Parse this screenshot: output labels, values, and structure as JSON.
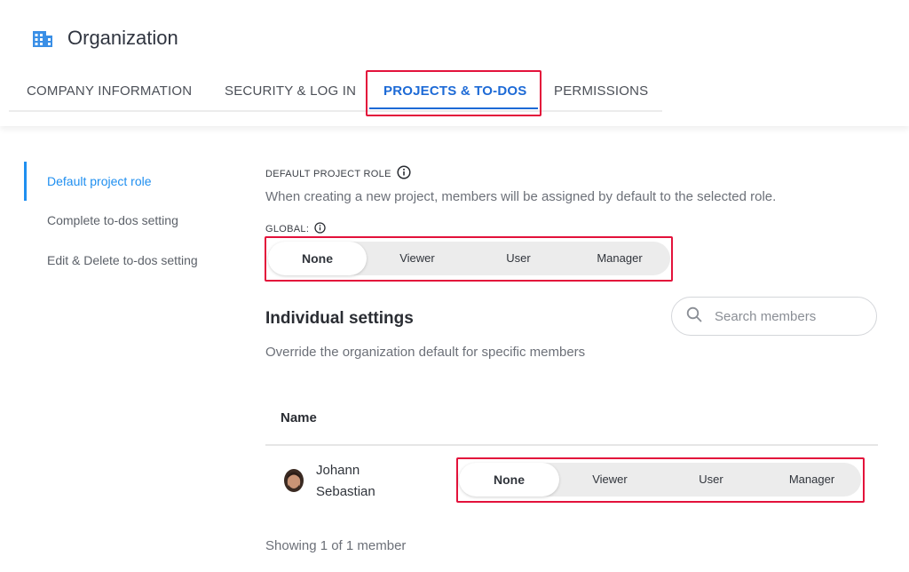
{
  "header": {
    "title": "Organization",
    "icon": "building-icon",
    "accent": "#1d6ad6"
  },
  "tabs": [
    {
      "label": "COMPANY INFORMATION",
      "active": false
    },
    {
      "label": "SECURITY & LOG IN",
      "active": false
    },
    {
      "label": "PROJECTS & TO-DOS",
      "active": true
    },
    {
      "label": "PERMISSIONS",
      "active": false
    }
  ],
  "sidebar": {
    "items": [
      {
        "label": "Default project role",
        "active": true
      },
      {
        "label": "Complete to-dos setting",
        "active": false
      },
      {
        "label": "Edit & Delete to-dos setting",
        "active": false
      }
    ]
  },
  "default_role": {
    "label": "DEFAULT PROJECT ROLE",
    "description": "When creating a new project, members will be assigned by default to the selected role.",
    "global_label": "GLOBAL:",
    "options": [
      "None",
      "Viewer",
      "User",
      "Manager"
    ],
    "selected": "None"
  },
  "individual": {
    "title": "Individual settings",
    "description": "Override the organization default for specific members",
    "search_placeholder": "Search members",
    "column_name": "Name",
    "members": [
      {
        "name": "Johann Sebastian",
        "options": [
          "None",
          "Viewer",
          "User",
          "Manager"
        ],
        "selected": "None"
      }
    ],
    "footer": "Showing 1 of 1 member"
  },
  "highlight_color": "#e3123b"
}
